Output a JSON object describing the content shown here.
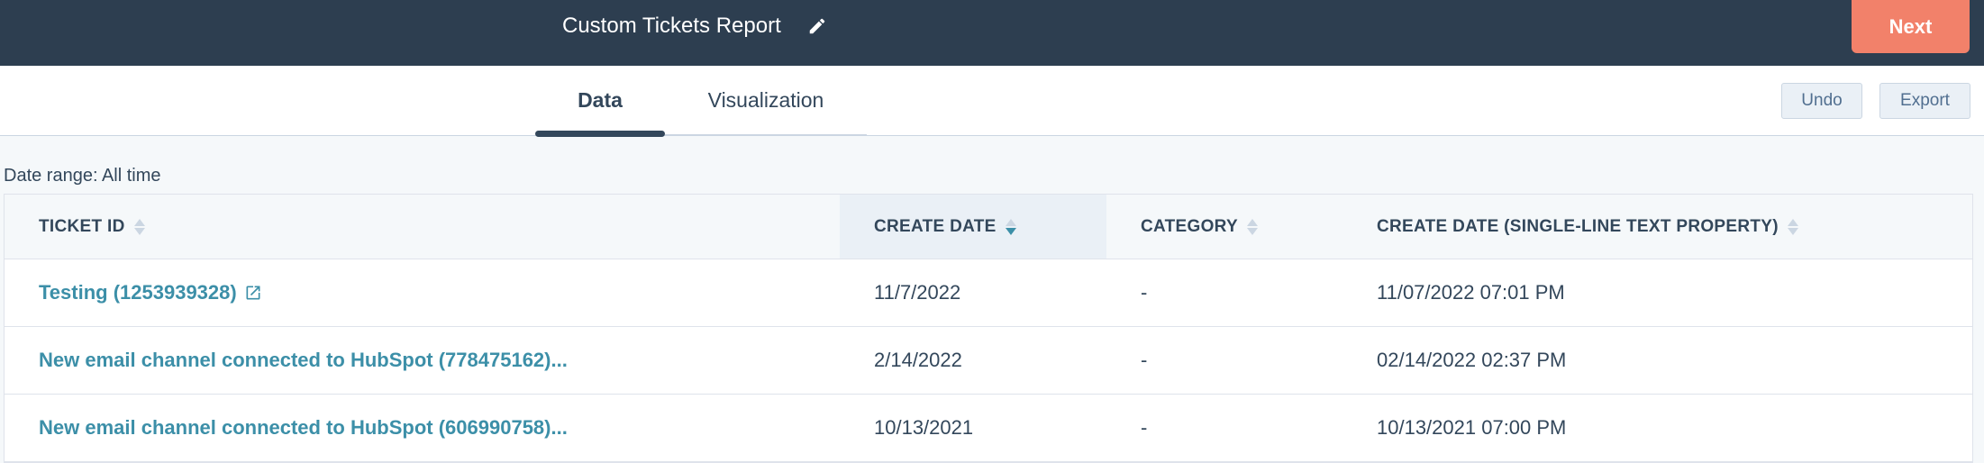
{
  "header": {
    "title": "Custom Tickets Report",
    "next_label": "Next"
  },
  "tabs": [
    {
      "label": "Data",
      "active": true
    },
    {
      "label": "Visualization",
      "active": false
    }
  ],
  "toolbar": {
    "undo_label": "Undo",
    "export_label": "Export"
  },
  "date_range": "Date range: All time",
  "table": {
    "columns": [
      "TICKET ID",
      "CREATE DATE",
      "CATEGORY",
      "CREATE DATE (SINGLE-LINE TEXT PROPERTY)"
    ],
    "sorted_column": "CREATE DATE",
    "sort_direction": "descending",
    "rows": [
      [
        "Testing (1253939328)",
        "11/7/2022",
        "-",
        "11/07/2022 07:01 PM"
      ],
      [
        "New email channel connected to HubSpot (778475162)...",
        "2/14/2022",
        "-",
        "02/14/2022 02:37 PM"
      ],
      [
        "New email channel connected to HubSpot (606990758)...",
        "10/13/2021",
        "-",
        "10/13/2021 07:00 PM"
      ]
    ]
  },
  "colors": {
    "header_bg": "#2d3e50",
    "accent": "#f2816a",
    "link": "#3c8fa8",
    "sort_active": "#3c8fa8"
  },
  "icons": {
    "edit": "pencil-icon",
    "sort": "sort-arrows-icon",
    "external": "external-link-icon"
  }
}
